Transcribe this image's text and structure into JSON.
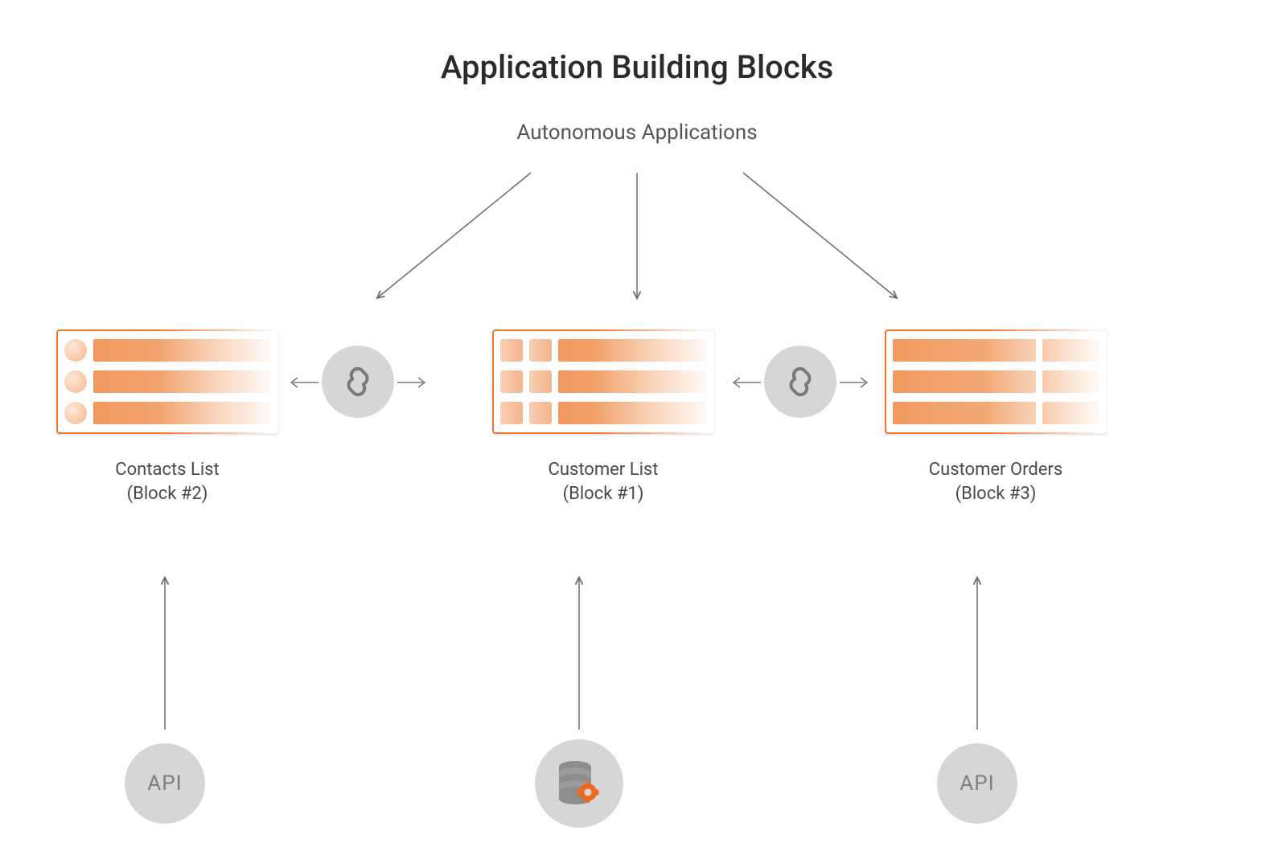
{
  "title": "Application Building Blocks",
  "subtitle": "Autonomous Applications",
  "blocks": [
    {
      "name": "Contacts List",
      "sub": "(Block #2)",
      "source": "API"
    },
    {
      "name": "Customer List",
      "sub": "(Block #1)",
      "source": "database"
    },
    {
      "name": "Customer Orders",
      "sub": "(Block #3)",
      "source": "API"
    }
  ],
  "api_label": "API",
  "colors": {
    "accent": "#ee7733",
    "circle_bg": "#d6d6d6",
    "text_dark": "#2b2b2b",
    "text_muted": "#555555"
  }
}
